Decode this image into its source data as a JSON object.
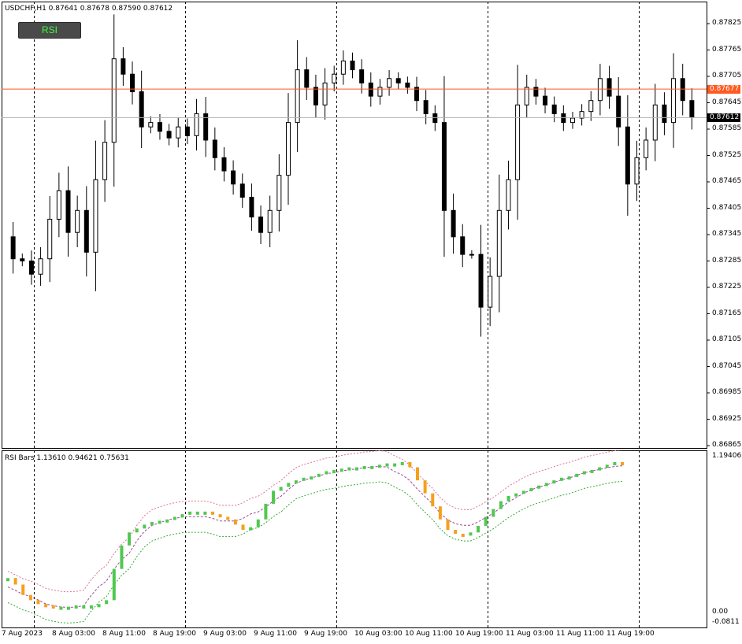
{
  "header": {
    "symbol_info": "USDCHF,H1  0.87641 0.87678 0.87590 0.87612",
    "rsi_info": "RSI Bars 1.13610 0.94621 0.75631"
  },
  "rsi_button": {
    "label": "RSI"
  },
  "price_labels": {
    "line1": "0.87677",
    "line2": "0.87612",
    "line1_color": "#ff5a1f",
    "line2_color": "#000000"
  },
  "chart_data": [
    {
      "type": "candlestick",
      "title": "USDCHF,H1",
      "ylim": [
        0.86865,
        0.87825
      ],
      "y_ticks": [
        "0.87825",
        "0.87765",
        "0.87705",
        "0.87645",
        "0.87585",
        "0.87525",
        "0.87465",
        "0.87405",
        "0.87345",
        "0.87285",
        "0.87225",
        "0.87165",
        "0.87105",
        "0.87045",
        "0.86985",
        "0.86925",
        "0.86865"
      ],
      "x_ticks": [
        "7 Aug 2023",
        "8 Aug 03:00",
        "8 Aug 11:00",
        "8 Aug 19:00",
        "9 Aug 03:00",
        "9 Aug 11:00",
        "9 Aug 19:00",
        "10 Aug 03:00",
        "10 Aug 11:00",
        "10 Aug 19:00",
        "11 Aug 03:00",
        "11 Aug 11:00",
        "11 Aug 19:00"
      ],
      "close_path": [
        0.8734,
        0.8729,
        0.87285,
        0.87255,
        0.8729,
        0.8738,
        0.87445,
        0.8735,
        0.874,
        0.87305,
        0.8747,
        0.87555,
        0.87745,
        0.8771,
        0.8767,
        0.8759,
        0.876,
        0.8758,
        0.87565,
        0.8759,
        0.8757,
        0.8762,
        0.8756,
        0.8752,
        0.8749,
        0.8746,
        0.8743,
        0.87385,
        0.8735,
        0.874,
        0.8748,
        0.876,
        0.8772,
        0.8768,
        0.8764,
        0.8769,
        0.8771,
        0.8774,
        0.8772,
        0.8769,
        0.8766,
        0.8768,
        0.877,
        0.8769,
        0.8768,
        0.8765,
        0.8762,
        0.876,
        0.874,
        0.8734,
        0.873,
        0.873,
        0.8718,
        0.8725,
        0.874,
        0.8747,
        0.8764,
        0.8768,
        0.8766,
        0.8764,
        0.8762,
        0.876,
        0.8761,
        0.87625,
        0.8765,
        0.877,
        0.8766,
        0.8759,
        0.8746,
        0.8752,
        0.8756,
        0.8764,
        0.876,
        0.877,
        0.8765,
        0.87612
      ],
      "price_lines": [
        0.87677,
        0.87612
      ]
    },
    {
      "type": "bar",
      "title": "RSI Bars",
      "values_shown": [
        1.1361,
        0.94621,
        0.75631
      ],
      "ylim": [
        -0.0811,
        1.19406
      ],
      "y_ticks": [
        "1.19406",
        "0.00",
        "-0.0811"
      ],
      "bar_colors": {
        "up": "#4fc84f",
        "down": "#f5a01a"
      },
      "band_colors": {
        "upper": "#e07090",
        "middle": "#9a4a9a",
        "lower": "#33aa33"
      },
      "series": [
        {
          "values": [
            0.25,
            0.2,
            0.12,
            0.08,
            0.05,
            0.04,
            0.03,
            0.03,
            0.03,
            0.04,
            0.04,
            0.04,
            0.05,
            0.08,
            0.32,
            0.5,
            0.6,
            0.63,
            0.66,
            0.68,
            0.69,
            0.7,
            0.72,
            0.74,
            0.76,
            0.76,
            0.76,
            0.74,
            0.72,
            0.7,
            0.66,
            0.62,
            0.64,
            0.7,
            0.82,
            0.92,
            0.95,
            0.98,
            1.0,
            1.02,
            1.03,
            1.05,
            1.07,
            1.08,
            1.09,
            1.1,
            1.1,
            1.11,
            1.11,
            1.12,
            1.13,
            1.13,
            1.14,
            1.1,
            1.0,
            0.9,
            0.8,
            0.7,
            0.62,
            0.59,
            0.58,
            0.6,
            0.65,
            0.72,
            0.78,
            0.84,
            0.88,
            0.9,
            0.92,
            0.94,
            0.96,
            0.98,
            1.0,
            1.02,
            1.03,
            1.05,
            1.07,
            1.08,
            1.1,
            1.12,
            1.14,
            1.136
          ]
        }
      ]
    }
  ]
}
